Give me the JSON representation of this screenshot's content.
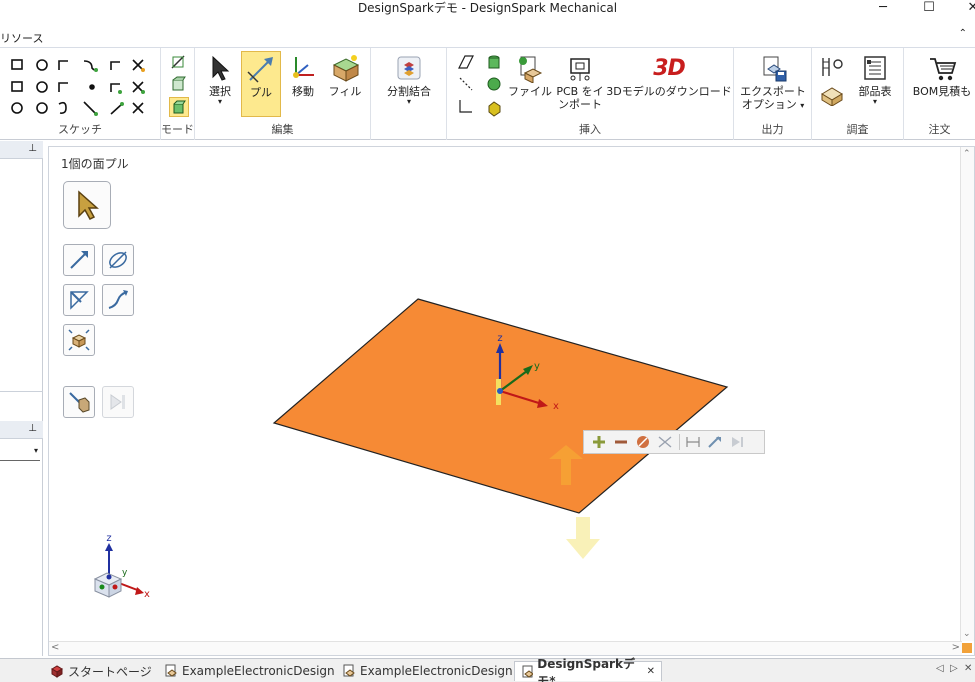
{
  "window": {
    "title": "DesignSparkデモ - DesignSpark Mechanical",
    "minimize": "─",
    "maximize": "☐",
    "close": "✕"
  },
  "ribbon_tab": "リソース",
  "ribbon": {
    "groups": {
      "sketch": "スケッチ",
      "mode": "モード",
      "edit": "編集",
      "insert": "挿入",
      "output": "出力",
      "inspect": "調査",
      "order": "注文"
    },
    "buttons": {
      "select": "選択",
      "pull": "プル",
      "move": "移動",
      "fill": "フィル",
      "split_combine": "分割結合",
      "file": "ファイル",
      "pcb_import_1": "PCB をイ",
      "pcb_import_2": "ンポート",
      "download_3d": "3Dモデルのダウンロード",
      "export_1": "エクスポート",
      "export_2": "オプション",
      "parts_list": "部品表",
      "bom_quote": "BOM見積も"
    },
    "logo_3d": "3D"
  },
  "viewport": {
    "status_title": "1個の面プル",
    "axis_labels": {
      "z": "z",
      "y": "y",
      "x": "x"
    },
    "face_color": "#f68a35"
  },
  "doc_tabs": [
    {
      "label": "スタートページ"
    },
    {
      "label": "ExampleElectronicDesign"
    },
    {
      "label": "ExampleElectronicDesign"
    },
    {
      "label": "DesignSparkデモ*"
    }
  ],
  "doc_tab_close": "✕",
  "icons": [
    "pin-icon",
    "cursor-icon",
    "pull-icon",
    "move-icon",
    "fill-icon",
    "plus-icon",
    "minus-icon",
    "stop-icon"
  ]
}
